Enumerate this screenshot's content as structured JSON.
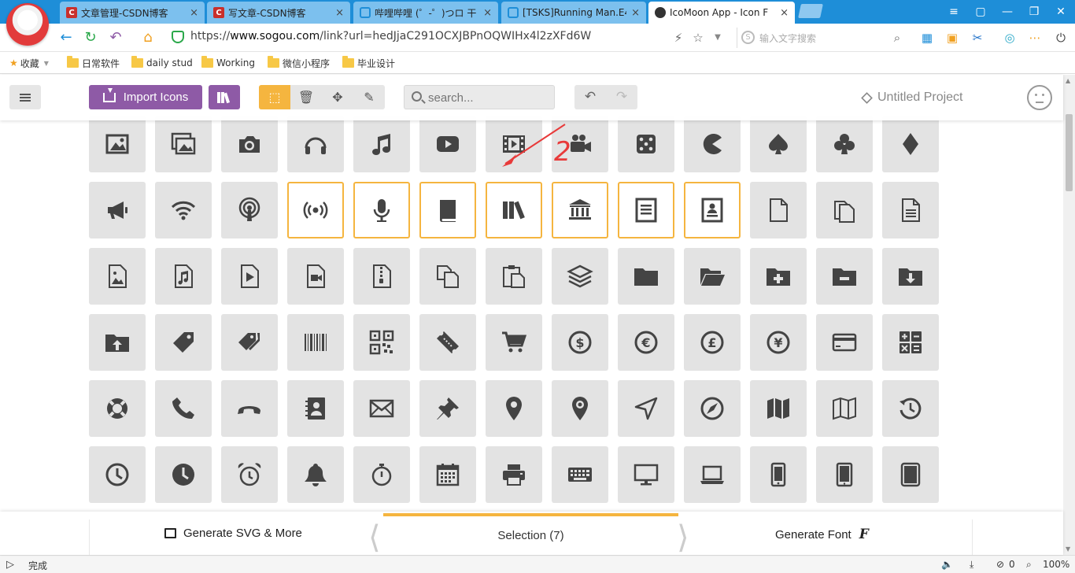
{
  "browser": {
    "tabs": [
      {
        "label": "文章管理-CSDN博客",
        "favicon": "csdn-icon",
        "close": "×"
      },
      {
        "label": "写文章-CSDN博客",
        "favicon": "csdn-icon",
        "close": "×"
      },
      {
        "label": "哔哩哔哩 (゜-゜)つロ 干",
        "favicon": "bilibili-icon",
        "close": "×"
      },
      {
        "label": "[TSKS]Running Man.E4",
        "favicon": "bilibili-icon",
        "close": "×"
      },
      {
        "label": "IcoMoon App - Icon F",
        "favicon": "icomoon-icon",
        "close": "×"
      }
    ],
    "url_prefix": "https://",
    "url_host": "www.sogou.com",
    "url_path": "/link?url=hedJjaC291OCXJBPnOQWIHx4l2zXFd6W",
    "search_placeholder": "输入文字搜索",
    "bookmarks": [
      {
        "label": "收藏",
        "icon": "star-icon"
      },
      {
        "label": "日常软件",
        "icon": "folder-icon"
      },
      {
        "label": "daily stud",
        "icon": "folder-icon"
      },
      {
        "label": "Working",
        "icon": "folder-icon"
      },
      {
        "label": "微信小程序",
        "icon": "folder-icon"
      },
      {
        "label": "毕业设计",
        "icon": "folder-icon"
      }
    ]
  },
  "toolbar": {
    "import_label": "Import Icons",
    "search_placeholder": "search...",
    "project_name": "Untitled Project"
  },
  "icons": {
    "rows": [
      [
        "image",
        "images",
        "camera",
        "headphones",
        "music",
        "play",
        "film",
        "video-camera",
        "dice",
        "pacman",
        "spades",
        "clubs",
        "diamonds"
      ],
      [
        "bullhorn",
        "connection",
        "podcast",
        "feed",
        "mic",
        "book",
        "books",
        "library",
        "file-text",
        "profile",
        "file-empty",
        "files-empty",
        "file-text2"
      ],
      [
        "file-picture",
        "file-music",
        "file-play",
        "file-video",
        "file-zip",
        "copy",
        "paste",
        "stack",
        "folder",
        "folder-open",
        "folder-plus",
        "folder-minus",
        "folder-download"
      ],
      [
        "folder-upload",
        "price-tag",
        "price-tags",
        "barcode",
        "qrcode",
        "ticket",
        "cart",
        "coin-dollar",
        "coin-euro",
        "coin-pound",
        "coin-yen",
        "credit-card",
        "calculator"
      ],
      [
        "lifebuoy",
        "phone",
        "phone-hang-up",
        "address-book",
        "envelop",
        "pushpin",
        "location",
        "location2",
        "compass",
        "compass2",
        "map",
        "map2",
        "history"
      ],
      [
        "clock",
        "clock2",
        "alarm",
        "bell",
        "stopwatch",
        "calendar",
        "printer",
        "keyboard",
        "display",
        "laptop",
        "mobile",
        "mobile2",
        "tablet"
      ]
    ],
    "selected": [
      "feed",
      "mic",
      "book",
      "books",
      "library",
      "file-text",
      "profile"
    ]
  },
  "annotation": {
    "text": "2",
    "color": "#e83a3a"
  },
  "bottom": {
    "generate_svg": "Generate SVG & More",
    "selection": "Selection (7)",
    "generate_font": "Generate Font",
    "font_glyph": "F"
  },
  "status": {
    "done": "完成",
    "count": "0",
    "zoom": "100%"
  },
  "colors": {
    "accent": "#f5b53f",
    "brand": "#8e5aa6",
    "tabbar": "#1e8ed8"
  }
}
